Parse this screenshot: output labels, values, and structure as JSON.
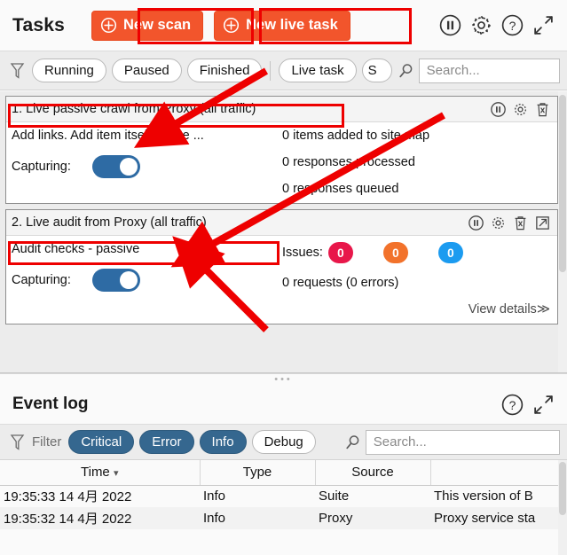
{
  "tasks_panel": {
    "title": "Tasks",
    "new_scan_label": "New scan",
    "new_live_task_label": "New live task",
    "header_icons": [
      "pause-icon",
      "settings-gear-icon",
      "help-question-icon",
      "expand-arrows-icon"
    ],
    "filters": {
      "funnel": "filter-funnel-icon",
      "pills": [
        {
          "label": "Running",
          "selected": false
        },
        {
          "label": "Paused",
          "selected": false
        },
        {
          "label": "Finished",
          "selected": false
        },
        {
          "label": "Live task",
          "selected": false
        },
        {
          "label": "S",
          "selected": false
        }
      ],
      "search_placeholder": "Search...",
      "search_value": ""
    },
    "cards": [
      {
        "title": "1. Live passive crawl from Proxy (all traffic)",
        "description": "Add links. Add item itself, same ...",
        "capturing_label": "Capturing:",
        "capturing_on": true,
        "stats": [
          "0 items added to site map",
          "0 responses processed",
          "0 responses queued"
        ],
        "icons": [
          "pause-icon",
          "settings-gear-icon",
          "delete-trash-icon"
        ]
      },
      {
        "title": "2. Live audit from Proxy (all traffic)",
        "description": "Audit checks - passive",
        "capturing_label": "Capturing:",
        "capturing_on": true,
        "issues_label": "Issues:",
        "issues": [
          {
            "count": "0",
            "color": "#e8174a"
          },
          {
            "count": "0",
            "color": "#f2722b"
          },
          {
            "count": "0",
            "color": "#1b9bf0"
          }
        ],
        "requests_text": "0 requests (0 errors)",
        "view_details_label": "View details",
        "icons": [
          "pause-icon",
          "settings-gear-icon",
          "delete-trash-icon",
          "open-external-icon"
        ]
      }
    ]
  },
  "event_log": {
    "title": "Event log",
    "header_icons": [
      "help-question-icon",
      "expand-arrows-icon"
    ],
    "filter_label": "Filter",
    "pills": [
      {
        "label": "Critical",
        "selected": true
      },
      {
        "label": "Error",
        "selected": true
      },
      {
        "label": "Info",
        "selected": true
      },
      {
        "label": "Debug",
        "selected": false
      }
    ],
    "search_placeholder": "Search...",
    "search_value": "",
    "columns": [
      "Time",
      "Type",
      "Source",
      ""
    ],
    "sorted_column": "Time",
    "rows": [
      {
        "time": "19:35:33 14 4月 2022",
        "type": "Info",
        "source": "Suite",
        "message": "This version of B"
      },
      {
        "time": "19:35:32 14 4月 2022",
        "type": "Info",
        "source": "Proxy",
        "message": "Proxy service sta"
      }
    ]
  },
  "theme": {
    "accent_orange": "#f2552c",
    "accent_blue": "#35678f",
    "toggle_blue": "#2e6ba4",
    "annotation_red": "#ee0000"
  },
  "annotations": {
    "boxes": [
      {
        "name": "new-scan-highlight"
      },
      {
        "name": "new-live-task-highlight"
      },
      {
        "name": "card1-title-highlight"
      },
      {
        "name": "card2-title-highlight"
      }
    ],
    "arrows": [
      {
        "name": "arrow-to-card1-title"
      },
      {
        "name": "arrow-to-card2-title"
      }
    ]
  }
}
